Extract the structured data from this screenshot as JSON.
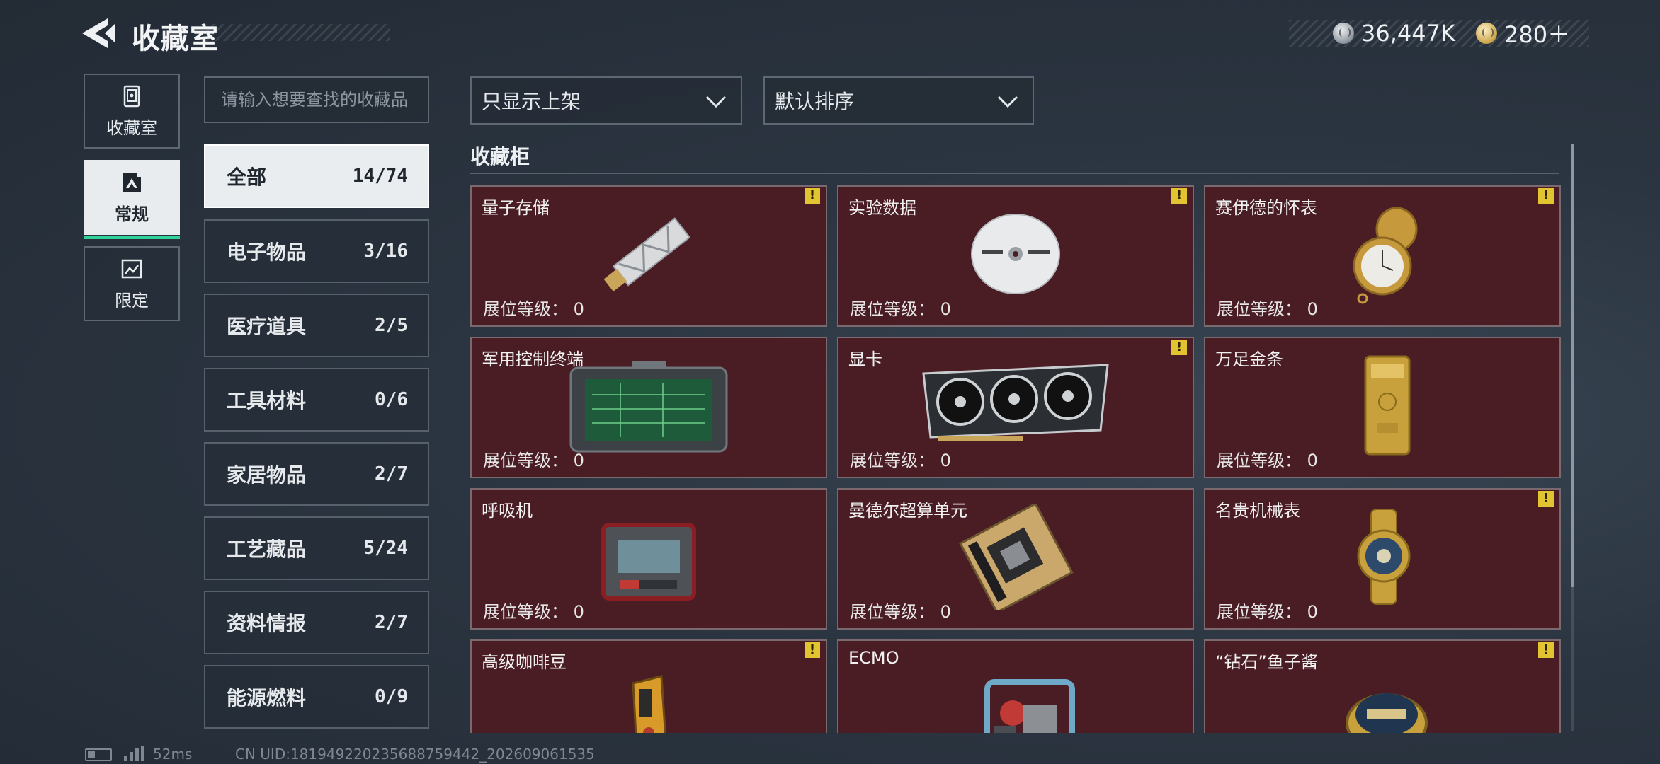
{
  "header": {
    "title": "收藏室",
    "currencies": [
      {
        "icon": "silver-coin-icon",
        "value": "36,447K"
      },
      {
        "icon": "gold-coin-icon",
        "value": "280＋"
      }
    ]
  },
  "sidenav": [
    {
      "label": "收藏室",
      "icon": "vault-icon",
      "active": false
    },
    {
      "label": "常规",
      "icon": "picture-frame-icon",
      "active": true
    },
    {
      "label": "限定",
      "icon": "limited-image-icon",
      "active": false
    }
  ],
  "search": {
    "placeholder": "请输入想要查找的收藏品",
    "value": ""
  },
  "filters": {
    "display": "只显示上架",
    "sort": "默认排序"
  },
  "categories": [
    {
      "label": "全部",
      "count": "14/74",
      "active": true
    },
    {
      "label": "电子物品",
      "count": "3/16"
    },
    {
      "label": "医疗道具",
      "count": "2/5"
    },
    {
      "label": "工具材料",
      "count": "0/6"
    },
    {
      "label": "家居物品",
      "count": "2/7"
    },
    {
      "label": "工艺藏品",
      "count": "5/24"
    },
    {
      "label": "资料情报",
      "count": "2/7"
    },
    {
      "label": "能源燃料",
      "count": "0/9"
    }
  ],
  "cabinet": {
    "title": "收藏柜",
    "level_label": "展位等级：",
    "items": [
      {
        "name": "量子存储",
        "level": "0",
        "warning": true,
        "icon": "usb-drive-icon"
      },
      {
        "name": "实验数据",
        "level": "0",
        "warning": true,
        "icon": "disc-icon"
      },
      {
        "name": "赛伊德的怀表",
        "level": "0",
        "warning": true,
        "icon": "pocket-watch-icon"
      },
      {
        "name": "军用控制终端",
        "level": "0",
        "warning": false,
        "icon": "control-terminal-icon"
      },
      {
        "name": "显卡",
        "level": "0",
        "warning": true,
        "icon": "graphics-card-icon"
      },
      {
        "name": "万足金条",
        "level": "0",
        "warning": false,
        "icon": "gold-bar-icon"
      },
      {
        "name": "呼吸机",
        "level": "0",
        "warning": false,
        "icon": "ventilator-icon"
      },
      {
        "name": "曼德尔超算单元",
        "level": "0",
        "warning": false,
        "icon": "cpu-board-icon"
      },
      {
        "name": "名贵机械表",
        "level": "0",
        "warning": true,
        "icon": "wristwatch-icon"
      },
      {
        "name": "高级咖啡豆",
        "level": "",
        "warning": true,
        "icon": "coffee-bag-icon"
      },
      {
        "name": "ECMO",
        "level": "",
        "warning": false,
        "icon": "ecmo-machine-icon"
      },
      {
        "name": "“钻石”鱼子酱",
        "level": "",
        "warning": true,
        "icon": "caviar-tin-icon"
      }
    ]
  },
  "footer": {
    "ping": "52ms",
    "uid": "CN UID:18194922023568875944​2_202609061535"
  },
  "colors": {
    "card_bg": "#4a1d24",
    "card_border": "#7a6a70",
    "warning": "#e2c430",
    "active_tab_accent": "#2fd39a",
    "background": "#2b3541"
  }
}
